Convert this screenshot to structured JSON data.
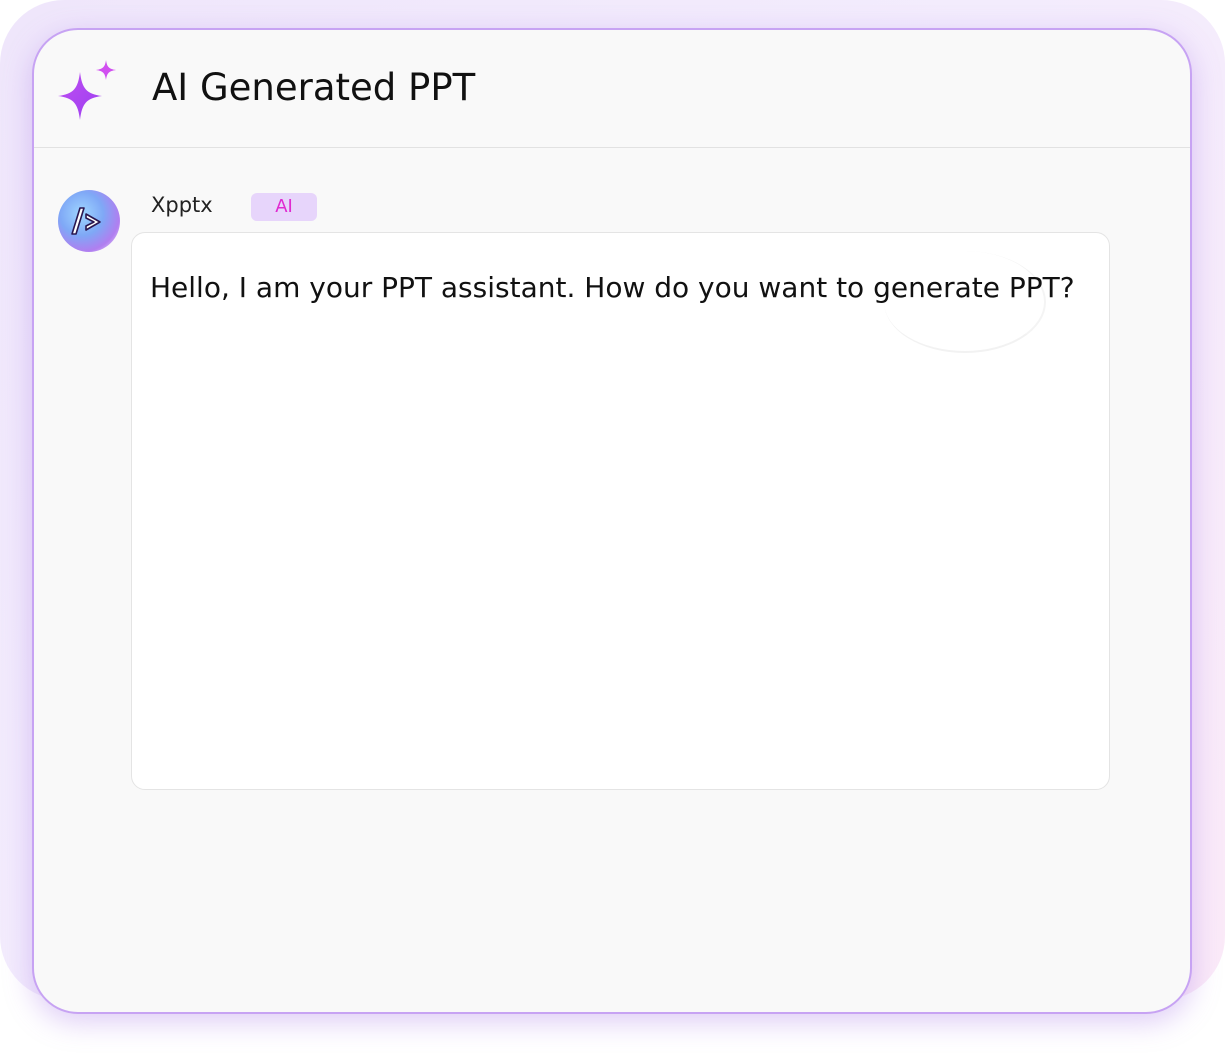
{
  "header": {
    "title": "AI Generated PPT",
    "icon": "sparkle-icon"
  },
  "message": {
    "sender": "Xpptx",
    "badge": "AI",
    "avatar_icon": "code-chevron-icon",
    "text": "Hello, I am your PPT assistant. How do you want to generate PPT?"
  },
  "colors": {
    "accent": "#a855f7",
    "badge_bg": "#e7d5fb",
    "badge_text": "#e02ad0",
    "border": "#c7a3f3"
  }
}
